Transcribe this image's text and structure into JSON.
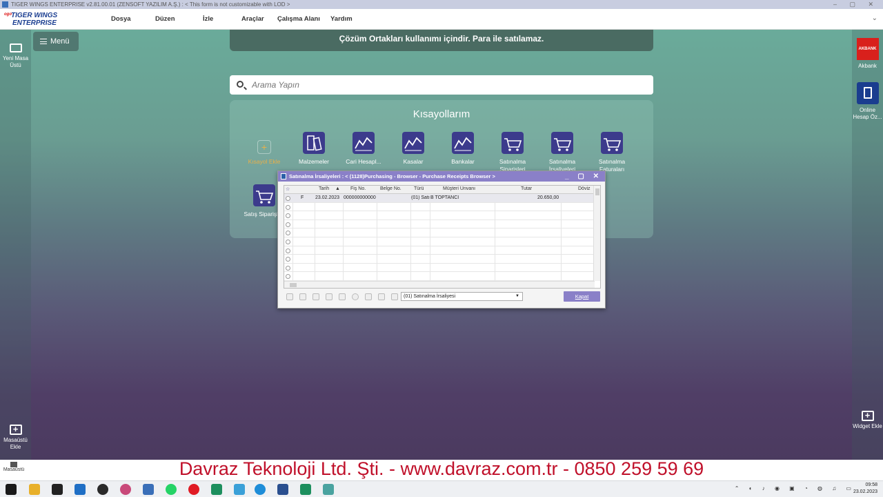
{
  "window": {
    "title": "TIGER WINGS ENTERPRISE v2.81.00.01 (ZENSOFT YAZILIM A.Ş.) : < This form is not customizable with LOD >"
  },
  "logo": {
    "small": "ogo",
    "line1": "TIGER WINGS",
    "line2": "ENTERPRISE"
  },
  "menu": [
    "Dosya",
    "Düzen",
    "İzle",
    "Araçlar",
    "Çalışma Alanı",
    "Yardım"
  ],
  "sidebar_left": {
    "new_desk": "Yeni Masa Üstü",
    "add_desk": "Masaüstü Ekle"
  },
  "sidebar_right": {
    "akbank": "Akbank",
    "akbank_logo": "AKBANK",
    "online": "Online Hesap Öz...",
    "widget": "Widget Ekle"
  },
  "menu_button": "Menü",
  "banner": "Çözüm Ortakları kullanımı içindir. Para ile satılamaz.",
  "search": {
    "placeholder": "Arama Yapın"
  },
  "shortcuts": {
    "title": "Kısayollarım",
    "add": "Kısayol Ekle",
    "items": [
      "Malzemeler",
      "Cari Hesapl...",
      "Kasalar",
      "Bankalar",
      "Satınalma Siparişleri",
      "Satınalma İrsaliyeleri",
      "Satınalma Faturaları",
      "Satış Siparişleri"
    ]
  },
  "dialog": {
    "title": "Satınalma İrsaliyeleri : < (1128)Purchasing - Browser - Purchase Receipts Browser >",
    "columns": [
      "Tarih",
      "Fiş No.",
      "Belge No.",
      "Türü",
      "Müşteri Unvanı",
      "Tutar",
      "Döviz"
    ],
    "rows": [
      {
        "flag": "F",
        "tarih": "23.02.2023",
        "fis_no": "000000000000",
        "belge_no": "",
        "turu": "(01) Satı",
        "musteri": "B TOPTANCI",
        "tutar": "20.650,00",
        "doviz": ""
      }
    ],
    "filter_select": "(01) Satınalma İrsaliyesi",
    "close_button": "Kapat"
  },
  "footer": {
    "text": "Davraz Teknoloji Ltd. Şti. - www.davraz.com.tr - 0850 259 59 69"
  },
  "home": {
    "label": "Masaüstü"
  },
  "taskbar": {
    "time": "09:58",
    "date": "23.02.2023"
  },
  "colors": {
    "accent": "#8a80c8",
    "tile": "#3c3b8c",
    "footer_text": "#c0102a"
  }
}
